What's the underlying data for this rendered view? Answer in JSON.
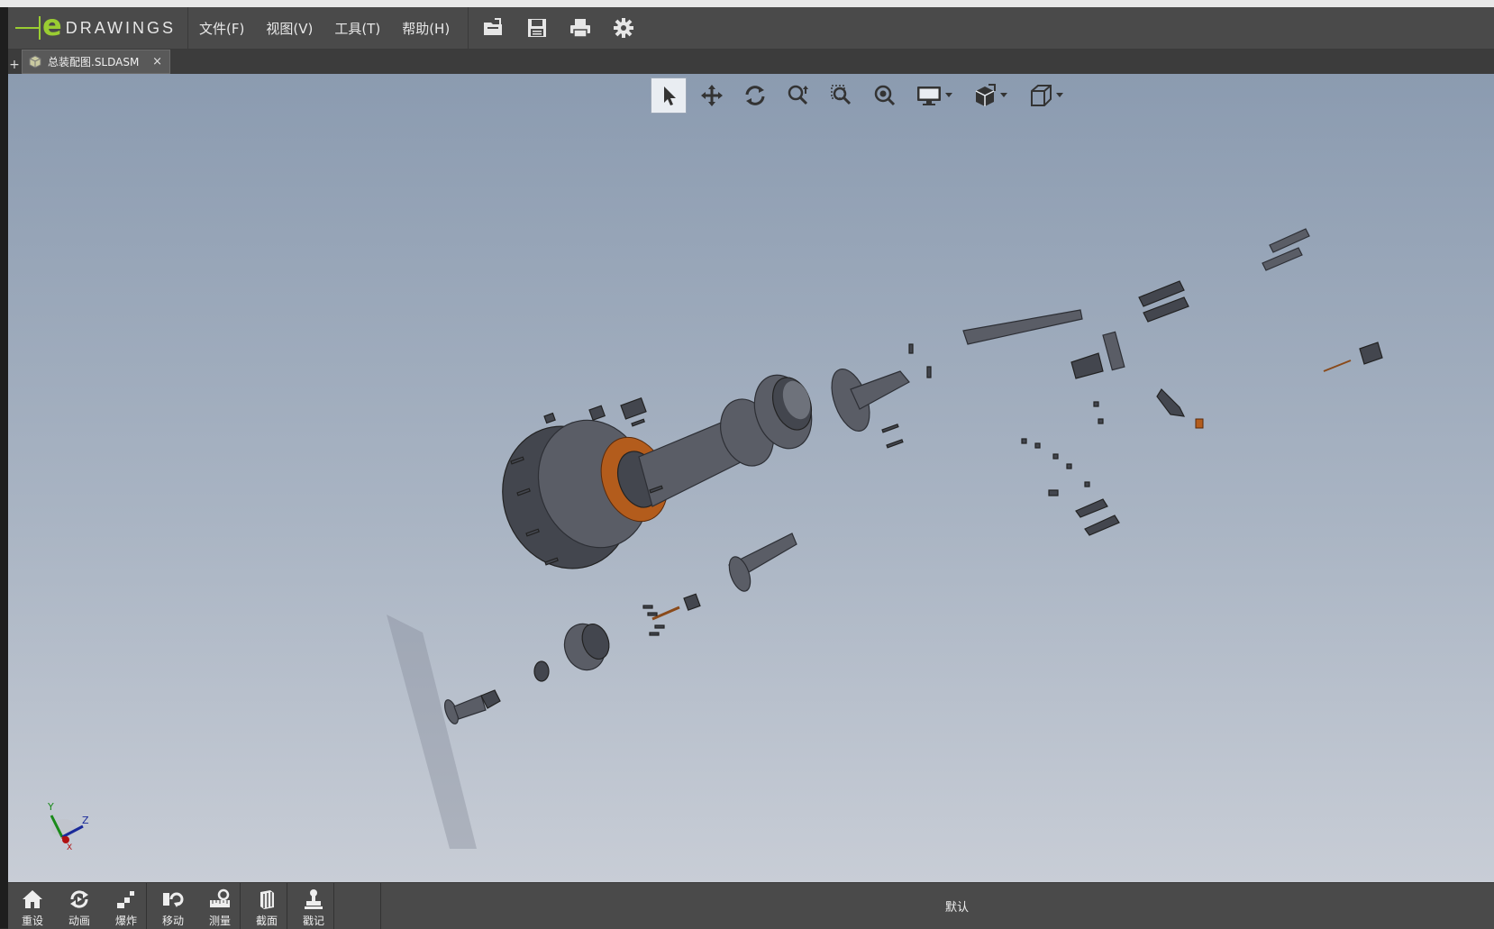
{
  "app": {
    "logo_letter": "e",
    "logo_word": "DRAWINGS",
    "menus": [
      "文件(F)",
      "视图(V)",
      "工具(T)",
      "帮助(H)"
    ],
    "toolbar_icons": [
      "open-folder-icon",
      "save-icon",
      "print-icon",
      "settings-gear-icon"
    ]
  },
  "tabs": [
    {
      "label": "总装配图.SLDASM",
      "close": "×"
    }
  ],
  "tab_add": "+",
  "view_toolbar": {
    "icons": [
      "select-arrow-icon",
      "pan-move-icon",
      "rotate-icon",
      "zoom-icon",
      "zoom-to-area-icon",
      "zoom-to-fit-icon",
      "display-style-icon",
      "view-orientation-icon",
      "projection-cube-icon"
    ]
  },
  "triad": {
    "x": "X",
    "y": "Y",
    "z": "Z"
  },
  "bottom_tools": [
    {
      "label": "重设",
      "icon": "home-icon"
    },
    {
      "label": "动画",
      "icon": "animate-icon"
    },
    {
      "label": "爆炸",
      "icon": "explode-icon"
    },
    {
      "label": "移动",
      "icon": "move-icon"
    },
    {
      "label": "测量",
      "icon": "measure-icon"
    },
    {
      "label": "截面",
      "icon": "section-icon"
    },
    {
      "label": "戳记",
      "icon": "stamp-icon"
    }
  ],
  "status": {
    "configuration": "默认"
  },
  "colors": {
    "chrome": "#4a4a4a",
    "accent": "#9acd32",
    "viewport_top": "#8b9bb0",
    "viewport_bottom": "#c8cdd6"
  }
}
